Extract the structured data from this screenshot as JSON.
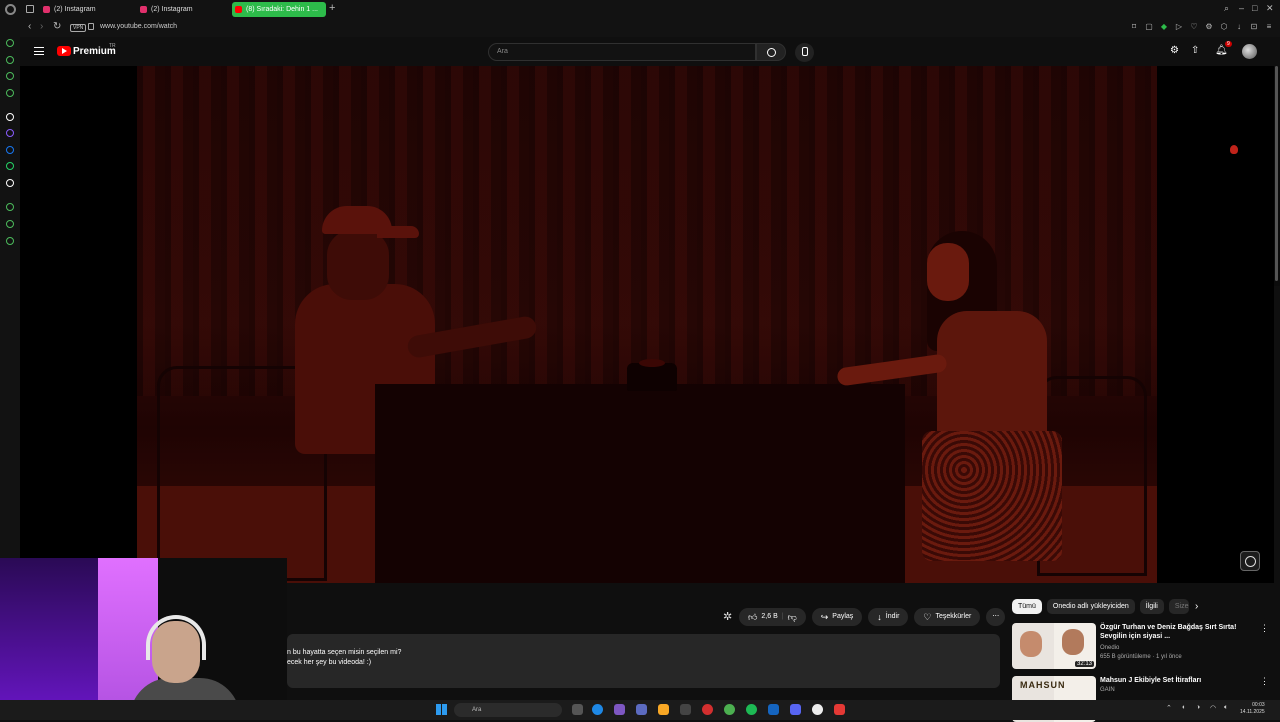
{
  "browser": {
    "tabs": [
      {
        "label": "(2) Instagram",
        "active": false,
        "favicon_color": "#e1306c"
      },
      {
        "label": "(2) Instagram",
        "active": false,
        "favicon_color": "#e1306c"
      },
      {
        "label": "(8) Sıradaki: Dehin 1 ...",
        "active": true,
        "favicon_color": "#ff0000"
      }
    ],
    "new_tab": "+",
    "vpn_badge": "VPN",
    "url": "www.youtube.com/watch",
    "accent_color": "#2dbb4a"
  },
  "youtube": {
    "logo_text": "Premium",
    "country_code": "TR",
    "search_placeholder": "Ara",
    "notification_count": "9",
    "brand_color": "#ff0000"
  },
  "actions": {
    "like_count": "2,6 B",
    "share_label": "Paylaş",
    "download_label": "İndir",
    "thanks_label": "Teşekkürler",
    "more": "⋯"
  },
  "description": {
    "line1": "n bu hayatta seçen misin seçilen mi?",
    "line2": "ecek her şey bu videoda! :)"
  },
  "chips": [
    "Tümü",
    "Onedio adlı yükleyiciden",
    "İlgili",
    "Size"
  ],
  "recommendations": [
    {
      "title": "Özgür Turhan ve Deniz Bağdaş Sırt Sırta! Sevgilin için siyasi ...",
      "channel": "Onedio",
      "meta": "655 B görüntüleme · 1 yıl önce",
      "duration": "32:13"
    },
    {
      "title": "Mahsun J Ekibiyle Set İtirafları",
      "channel": "GAIN",
      "meta": "",
      "thumb_text": "MAHSUN"
    }
  ],
  "taskbar": {
    "search_placeholder": "Ara",
    "time": "00:03",
    "date": "14.11.2025"
  }
}
